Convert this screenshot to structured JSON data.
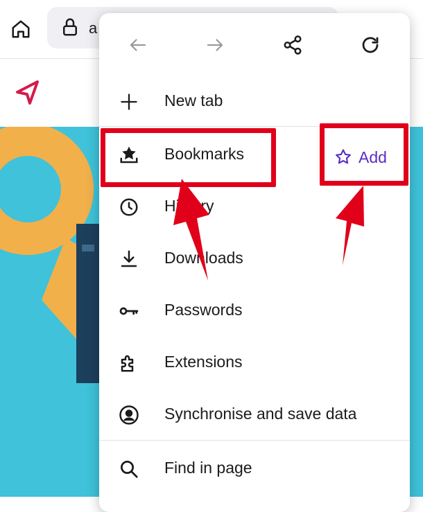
{
  "toolbar": {
    "url_text": "a",
    "icons": [
      "home-icon",
      "lock-icon"
    ]
  },
  "site": {
    "logo_icon": "send-arrow-logo",
    "logo_color": "#d31c4a"
  },
  "menu": {
    "nav": {
      "icons": [
        "back-arrow-icon",
        "forward-arrow-icon",
        "share-icon",
        "reload-icon"
      ]
    },
    "items": [
      {
        "label": "New tab",
        "icon": "plus-icon"
      },
      {
        "label": "Bookmarks",
        "icon": "bookmark-star-icon"
      },
      {
        "label": "History",
        "icon": "clock-icon"
      },
      {
        "label": "Downloads",
        "icon": "download-icon"
      },
      {
        "label": "Passwords",
        "icon": "key-icon"
      },
      {
        "label": "Extensions",
        "icon": "puzzle-icon"
      },
      {
        "label": "Synchronise and save data",
        "icon": "account-icon"
      },
      {
        "label": "Find in page",
        "icon": "search-icon"
      }
    ],
    "add_bookmark_label": "Add",
    "accent_color": "#5b2bc4"
  },
  "annotations": {
    "color": "#e0001a"
  }
}
